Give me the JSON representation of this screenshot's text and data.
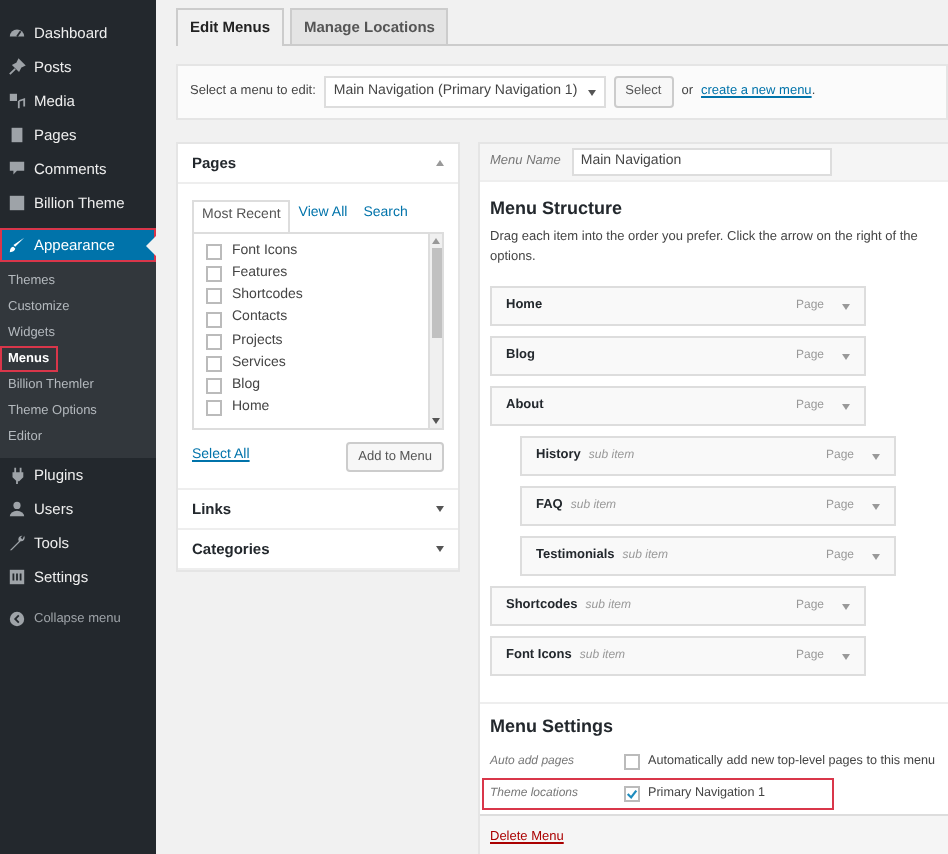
{
  "sidebar": {
    "items": [
      {
        "label": "Dashboard",
        "selected": false,
        "highlighted": false
      },
      {
        "label": "Posts",
        "selected": false,
        "highlighted": false
      },
      {
        "label": "Media",
        "selected": false,
        "highlighted": false
      },
      {
        "label": "Pages",
        "selected": false,
        "highlighted": false
      },
      {
        "label": "Comments",
        "selected": false,
        "highlighted": false
      },
      {
        "label": "Billion Theme",
        "selected": false,
        "highlighted": false
      },
      {
        "label": "Appearance",
        "selected": true,
        "highlighted": true,
        "children": [
          {
            "label": "Themes",
            "selected": false,
            "highlighted": false
          },
          {
            "label": "Customize",
            "selected": false,
            "highlighted": false
          },
          {
            "label": "Widgets",
            "selected": false,
            "highlighted": false
          },
          {
            "label": "Menus",
            "selected": true,
            "highlighted": true
          },
          {
            "label": "Billion Themler",
            "selected": false,
            "highlighted": false
          },
          {
            "label": "Theme Options",
            "selected": false,
            "highlighted": false
          },
          {
            "label": "Editor",
            "selected": false,
            "highlighted": false
          }
        ]
      },
      {
        "label": "Plugins",
        "selected": false,
        "highlighted": false
      },
      {
        "label": "Users",
        "selected": false,
        "highlighted": false
      },
      {
        "label": "Tools",
        "selected": false,
        "highlighted": false
      },
      {
        "label": "Settings",
        "selected": false,
        "highlighted": false
      }
    ],
    "collapse": "Collapse menu"
  },
  "tabs": [
    {
      "label": "Edit Menus",
      "selected": true
    },
    {
      "label": "Manage Locations",
      "selected": false
    }
  ],
  "menu_select": {
    "label": "Select a menu to edit:",
    "value": "Main Navigation (Primary Navigation 1)",
    "button": "Select",
    "or_text": "or",
    "link": "create a new menu",
    "end": "."
  },
  "pages_panel": {
    "title": "Pages",
    "tabs": [
      {
        "label": "Most Recent",
        "selected": true
      },
      {
        "label": "View All",
        "selected": false
      },
      {
        "label": "Search",
        "selected": false
      }
    ],
    "pages": [
      {
        "label": "Font Icons",
        "checked": false
      },
      {
        "label": "Features",
        "checked": false
      },
      {
        "label": "Shortcodes",
        "checked": false
      },
      {
        "label": "Contacts",
        "checked": false
      },
      {
        "label": "Projects",
        "checked": false
      },
      {
        "label": "Services",
        "checked": false
      },
      {
        "label": "Blog",
        "checked": false
      },
      {
        "label": "Home",
        "checked": false
      }
    ],
    "select_all": "Select All",
    "add_button": "Add to Menu"
  },
  "other_panels": [
    {
      "title": "Links",
      "expanded": false
    },
    {
      "title": "Categories",
      "expanded": false
    }
  ],
  "menu_editor": {
    "name_label": "Menu Name",
    "name_value": "Main Navigation",
    "structure_title": "Menu Structure",
    "description": [
      "Drag each item into the order you prefer. Click the arrow on the right of the",
      "options."
    ],
    "items": [
      {
        "label": "Home",
        "type": "Page"
      },
      {
        "label": "Blog",
        "type": "Page"
      },
      {
        "label": "About",
        "type": "Page",
        "children": [
          {
            "label": "History",
            "sub_label": "sub item",
            "type": "Page"
          },
          {
            "label": "FAQ",
            "sub_label": "sub item",
            "type": "Page"
          },
          {
            "label": "Testimonials",
            "sub_label": "sub item",
            "type": "Page"
          }
        ]
      },
      {
        "label": "Shortcodes",
        "sub_label": "sub item",
        "type": "Page"
      },
      {
        "label": "Font Icons",
        "sub_label": "sub item",
        "type": "Page"
      }
    ],
    "settings_title": "Menu Settings",
    "settings": [
      {
        "label": "Auto add pages",
        "option": "Automatically add new top-level pages to this menu",
        "checked": false,
        "highlighted": false
      },
      {
        "label": "Theme locations",
        "option": "Primary Navigation 1",
        "checked": true,
        "highlighted": true
      }
    ],
    "delete_link": "Delete Menu"
  }
}
